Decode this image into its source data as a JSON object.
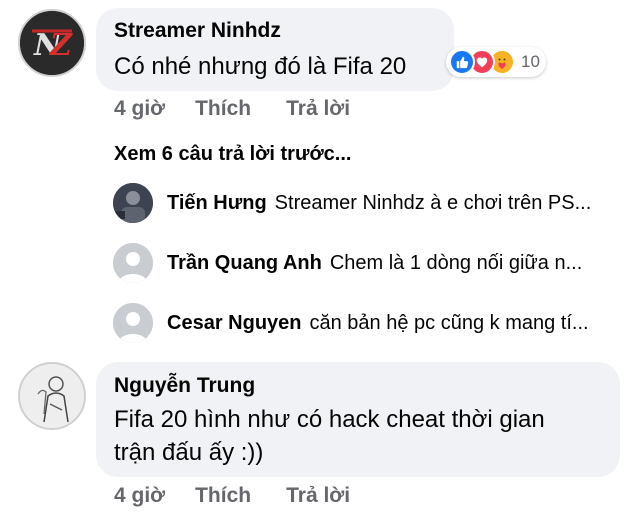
{
  "comments": [
    {
      "author": "Streamer Ninhdz",
      "avatar_initials": "NZ",
      "text": "Có nhé nhưng đó là Fifa 20",
      "reactions": {
        "icons": [
          "like-icon",
          "love-icon",
          "care-icon"
        ],
        "count": "10"
      },
      "actions": {
        "time": "4 giờ",
        "like": "Thích",
        "reply": "Trả lời"
      }
    },
    {
      "author": "Nguyễn Trung",
      "text_line1": "Fifa 20 hình như có hack cheat thời gian",
      "text_line2": "trận đấu ấy :))",
      "actions": {
        "time": "4 giờ",
        "like": "Thích",
        "reply": "Trả lời"
      }
    }
  ],
  "view_previous": "Xem 6 câu trả lời trước...",
  "replies": [
    {
      "author": "Tiến Hưng",
      "text": "Streamer Ninhdz à e chơi trên PS..."
    },
    {
      "author": "Trần Quang Anh",
      "text": "Chem là 1 dòng nối giữa n..."
    },
    {
      "author": "Cesar Nguyen",
      "text": "căn bản hệ pc cũng k mang tí..."
    }
  ],
  "colors": {
    "bubble": "#f0f2f5",
    "secondary_text": "#65676b",
    "like_blue": "#1877f2",
    "love_red": "#f33e58",
    "care_yellow": "#f7b125"
  }
}
